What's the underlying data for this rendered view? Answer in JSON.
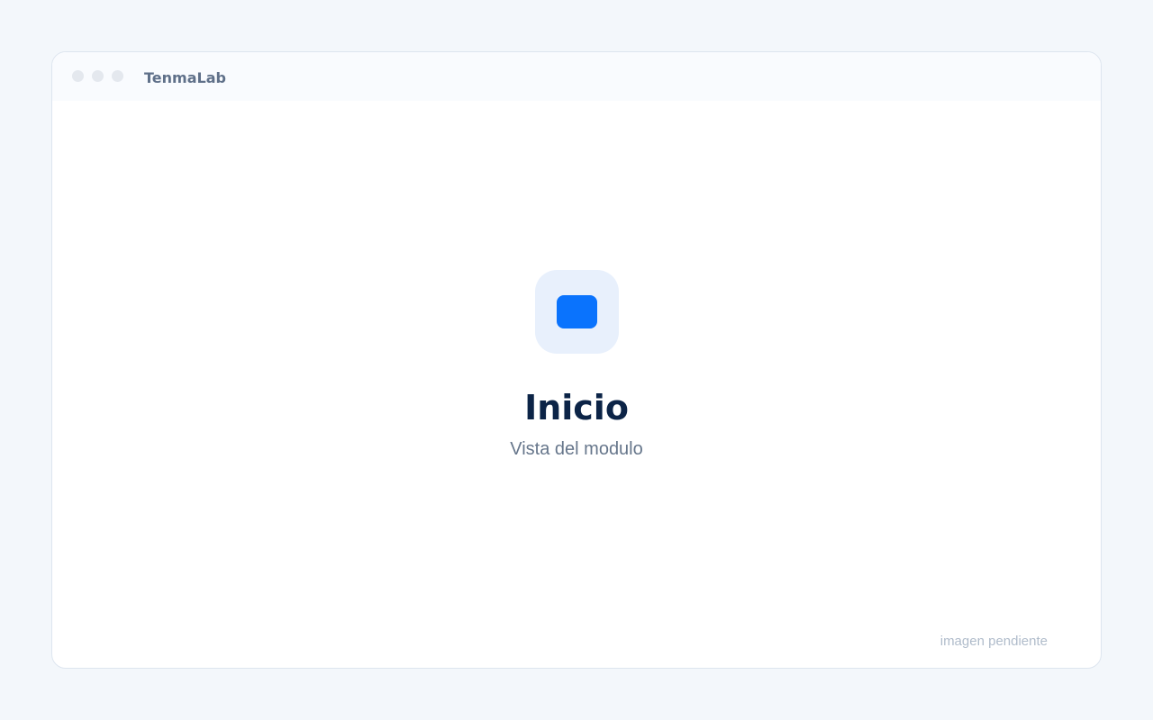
{
  "app": {
    "title": "TenmaLab"
  },
  "main": {
    "icon": "module-icon",
    "title": "Inicio",
    "subtitle": "Vista del modulo"
  },
  "footer": {
    "note": "imagen pendiente"
  },
  "colors": {
    "accent": "#0a73fd",
    "icon_tile": "#e8f0fc",
    "title": "#0c2447",
    "subtitle": "#66768b",
    "background": "#f3f7fb"
  }
}
